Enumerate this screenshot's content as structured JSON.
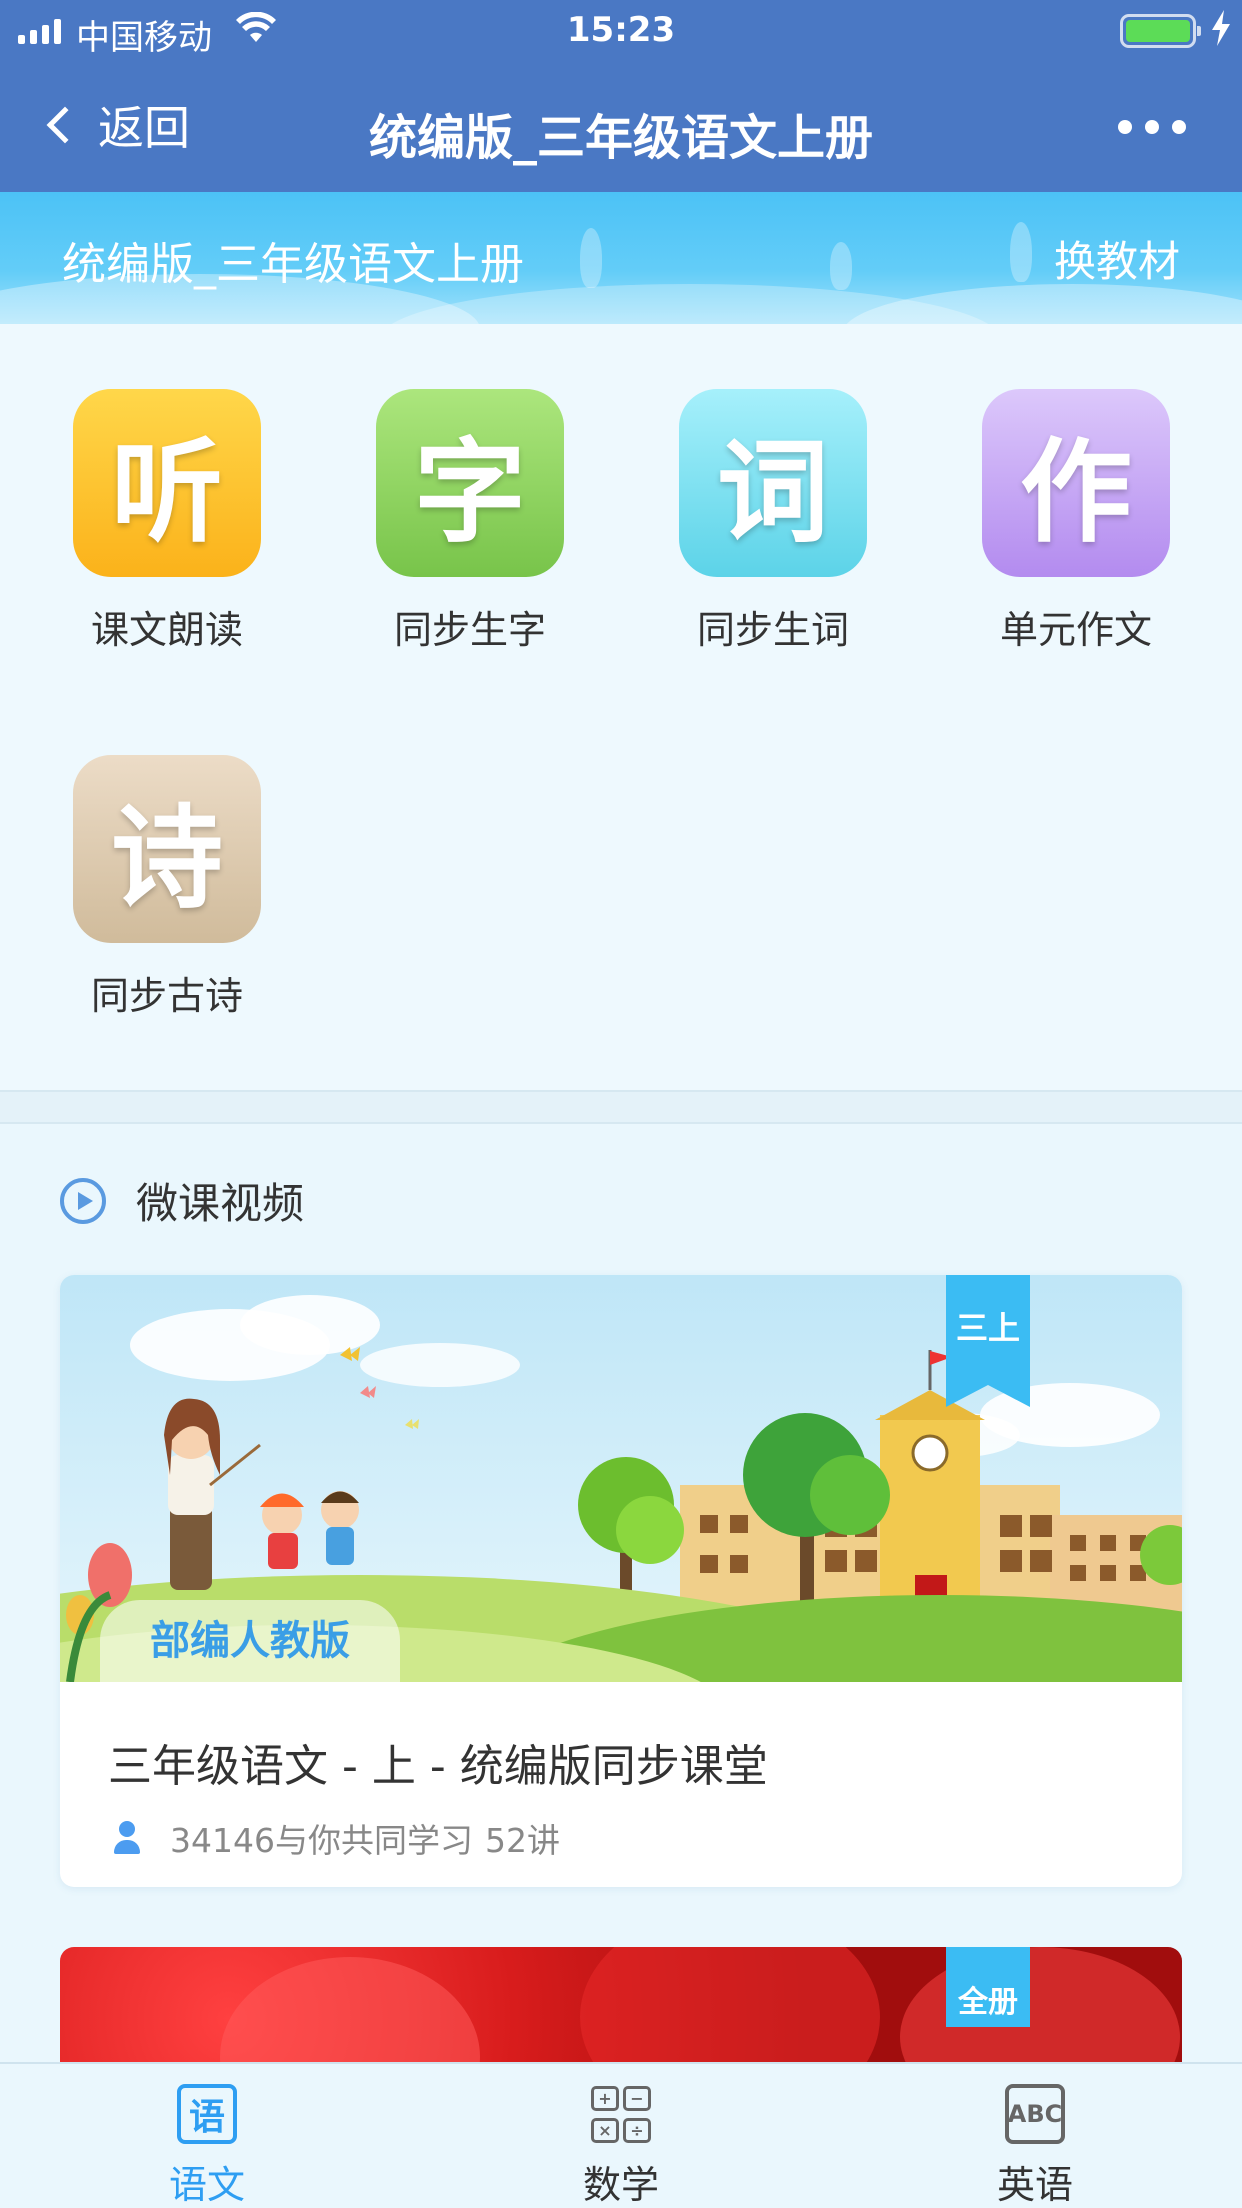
{
  "status_bar": {
    "carrier": "中国移动",
    "time": "15:23"
  },
  "nav": {
    "back_label": "返回",
    "title": "统编版_三年级语文上册"
  },
  "banner": {
    "book_name": "统编版_三年级语文上册",
    "switch_label": "换教材"
  },
  "features": [
    {
      "glyph": "听",
      "label": "课文朗读",
      "color": "#fcc232"
    },
    {
      "glyph": "字",
      "label": "同步生字",
      "color": "#8fd25f"
    },
    {
      "glyph": "词",
      "label": "同步生词",
      "color": "#7fe0f0"
    },
    {
      "glyph": "作",
      "label": "单元作文",
      "color": "#c7a8f6"
    },
    {
      "glyph": "诗",
      "label": "同步古诗",
      "color": "#ddc9ad"
    }
  ],
  "micro_video": {
    "section_title": "微课视频",
    "courses": [
      {
        "grade_badge": "三上",
        "publisher_tag": "部编人教版",
        "title": "三年级语文 - 上 - 统编版同步课堂",
        "learners": "34146与你共同学习",
        "lessons": "52讲"
      },
      {
        "grade_badge": "全册"
      }
    ]
  },
  "tabs": [
    {
      "label": "语文",
      "icon": "chinese-tab-icon",
      "active": true
    },
    {
      "label": "数学",
      "icon": "math-tab-icon",
      "active": false
    },
    {
      "label": "英语",
      "icon": "english-tab-icon",
      "active": false
    }
  ],
  "colors": {
    "nav_blue": "#4a78c4",
    "accent_blue": "#2e9ef2",
    "page_bg": "#eaf7fd"
  }
}
